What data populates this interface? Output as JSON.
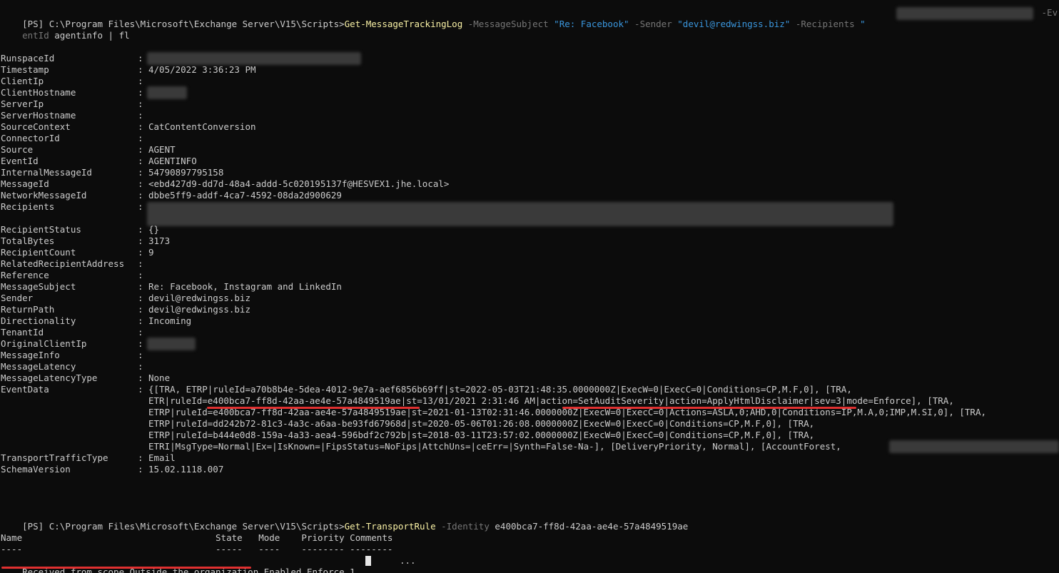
{
  "prompt1": {
    "prefix": "[PS] C:\\Program Files\\Microsoft\\Exchange Server\\V15\\Scripts>",
    "cmdlet": "Get-MessageTrackingLog",
    "p1": " -MessageSubject ",
    "v1": "\"Re: Facebook\"",
    "p2": " -Sender ",
    "v2": "\"devil@redwingss.biz\"",
    "p3": " -Recipients ",
    "v3": "\"",
    "p4": " -Ev",
    "wrap_param": "entId",
    "wrap_rest": " agentinfo | fl"
  },
  "fields": [
    {
      "label": "RunspaceId",
      "value": ""
    },
    {
      "label": "Timestamp",
      "value": "4/05/2022 3:36:23 PM"
    },
    {
      "label": "ClientIp",
      "value": ""
    },
    {
      "label": "ClientHostname",
      "value": ""
    },
    {
      "label": "ServerIp",
      "value": ""
    },
    {
      "label": "ServerHostname",
      "value": ""
    },
    {
      "label": "SourceContext",
      "value": "CatContentConversion"
    },
    {
      "label": "ConnectorId",
      "value": ""
    },
    {
      "label": "Source",
      "value": "AGENT"
    },
    {
      "label": "EventId",
      "value": "AGENTINFO"
    },
    {
      "label": "InternalMessageId",
      "value": "54790897795158"
    },
    {
      "label": "MessageId",
      "value": "<ebd427d9-dd7d-48a4-addd-5c020195137f@HESVEX1.jhe.local>"
    },
    {
      "label": "NetworkMessageId",
      "value": "dbbe5ff9-addf-4ca7-4592-08da2d900629"
    },
    {
      "label": "Recipients",
      "value": ""
    }
  ],
  "fields2": [
    {
      "label": "RecipientStatus",
      "value": "{}"
    },
    {
      "label": "TotalBytes",
      "value": "3173"
    },
    {
      "label": "RecipientCount",
      "value": "9"
    },
    {
      "label": "RelatedRecipientAddress",
      "value": ""
    },
    {
      "label": "Reference",
      "value": ""
    },
    {
      "label": "MessageSubject",
      "value": "Re: Facebook, Instagram and LinkedIn"
    },
    {
      "label": "Sender",
      "value": "devil@redwingss.biz"
    },
    {
      "label": "ReturnPath",
      "value": "devil@redwingss.biz"
    },
    {
      "label": "Directionality",
      "value": "Incoming"
    },
    {
      "label": "TenantId",
      "value": ""
    },
    {
      "label": "OriginalClientIp",
      "value": ""
    },
    {
      "label": "MessageInfo",
      "value": ""
    },
    {
      "label": "MessageLatency",
      "value": ""
    },
    {
      "label": "MessageLatencyType",
      "value": "None"
    },
    {
      "label": "EventData",
      "value": "{[TRA, ETRP|ruleId=a70b8b4e-5dea-4012-9e7a-aef6856b69ff|st=2022-05-03T21:48:35.0000000Z|ExecW=0|ExecC=0|Conditions=CP,M.F,0], [TRA,"
    }
  ],
  "eventdata_cont": [
    "ETR|ruleId=e400bca7-ff8d-42aa-ae4e-57a4849519ae|st=13/01/2021 2:31:46 AM|action=SetAuditSeverity|action=ApplyHtmlDisclaimer|sev=3|mode=Enforce], [TRA,",
    "ETRP|ruleId=e400bca7-ff8d-42aa-ae4e-57a4849519ae|st=2021-01-13T02:31:46.0000000Z|ExecW=0|ExecC=0|Actions=ASLA,0;AHD,0|Conditions=IP,M.A,0;IMP,M.SI,0], [TRA,",
    "ETRP|ruleId=dd242b72-81c3-4a3c-a6aa-be93fd67968d|st=2020-05-06T01:26:08.0000000Z|ExecW=0|ExecC=0|Conditions=CP,M.F,0], [TRA,",
    "ETRP|ruleId=b444e0d8-159a-4a33-aea4-596bdf2c792b|st=2018-03-11T23:57:02.0000000Z|ExecW=0|ExecC=0|Conditions=CP,M.F,0], [TRA,",
    "ETRI|MsgType=Normal|Ex=|IsKnown=|FipsStatus=NoFips|AttchUns=|ceErr=|Synth=False-Na-], [DeliveryPriority, Normal], [AccountForest,"
  ],
  "fields3": [
    {
      "label": "TransportTrafficType",
      "value": "Email"
    },
    {
      "label": "SchemaVersion",
      "value": "15.02.1118.007"
    }
  ],
  "prompt2": {
    "prefix": "[PS] C:\\Program Files\\Microsoft\\Exchange Server\\V15\\Scripts>",
    "cmdlet": "Get-TransportRule",
    "p1": " -Identity ",
    "v1": "e400bca7-ff8d-42aa-ae4e-57a4849519ae"
  },
  "table": {
    "header": "Name                                    State   Mode    Priority Comments",
    "dashes": "----                                    -----   ----    -------- --------",
    "row_name": "Received from scope Outside the organization",
    "row_rest": " Enabled Enforce 1",
    "row_comments": "..."
  },
  "colon": ":",
  "colors": {
    "background": "#0c0c0c",
    "text": "#cccccc",
    "cmdlet": "#f9f1a5",
    "param": "#767676",
    "string": "#3a96dd",
    "underline": "#e03030"
  }
}
